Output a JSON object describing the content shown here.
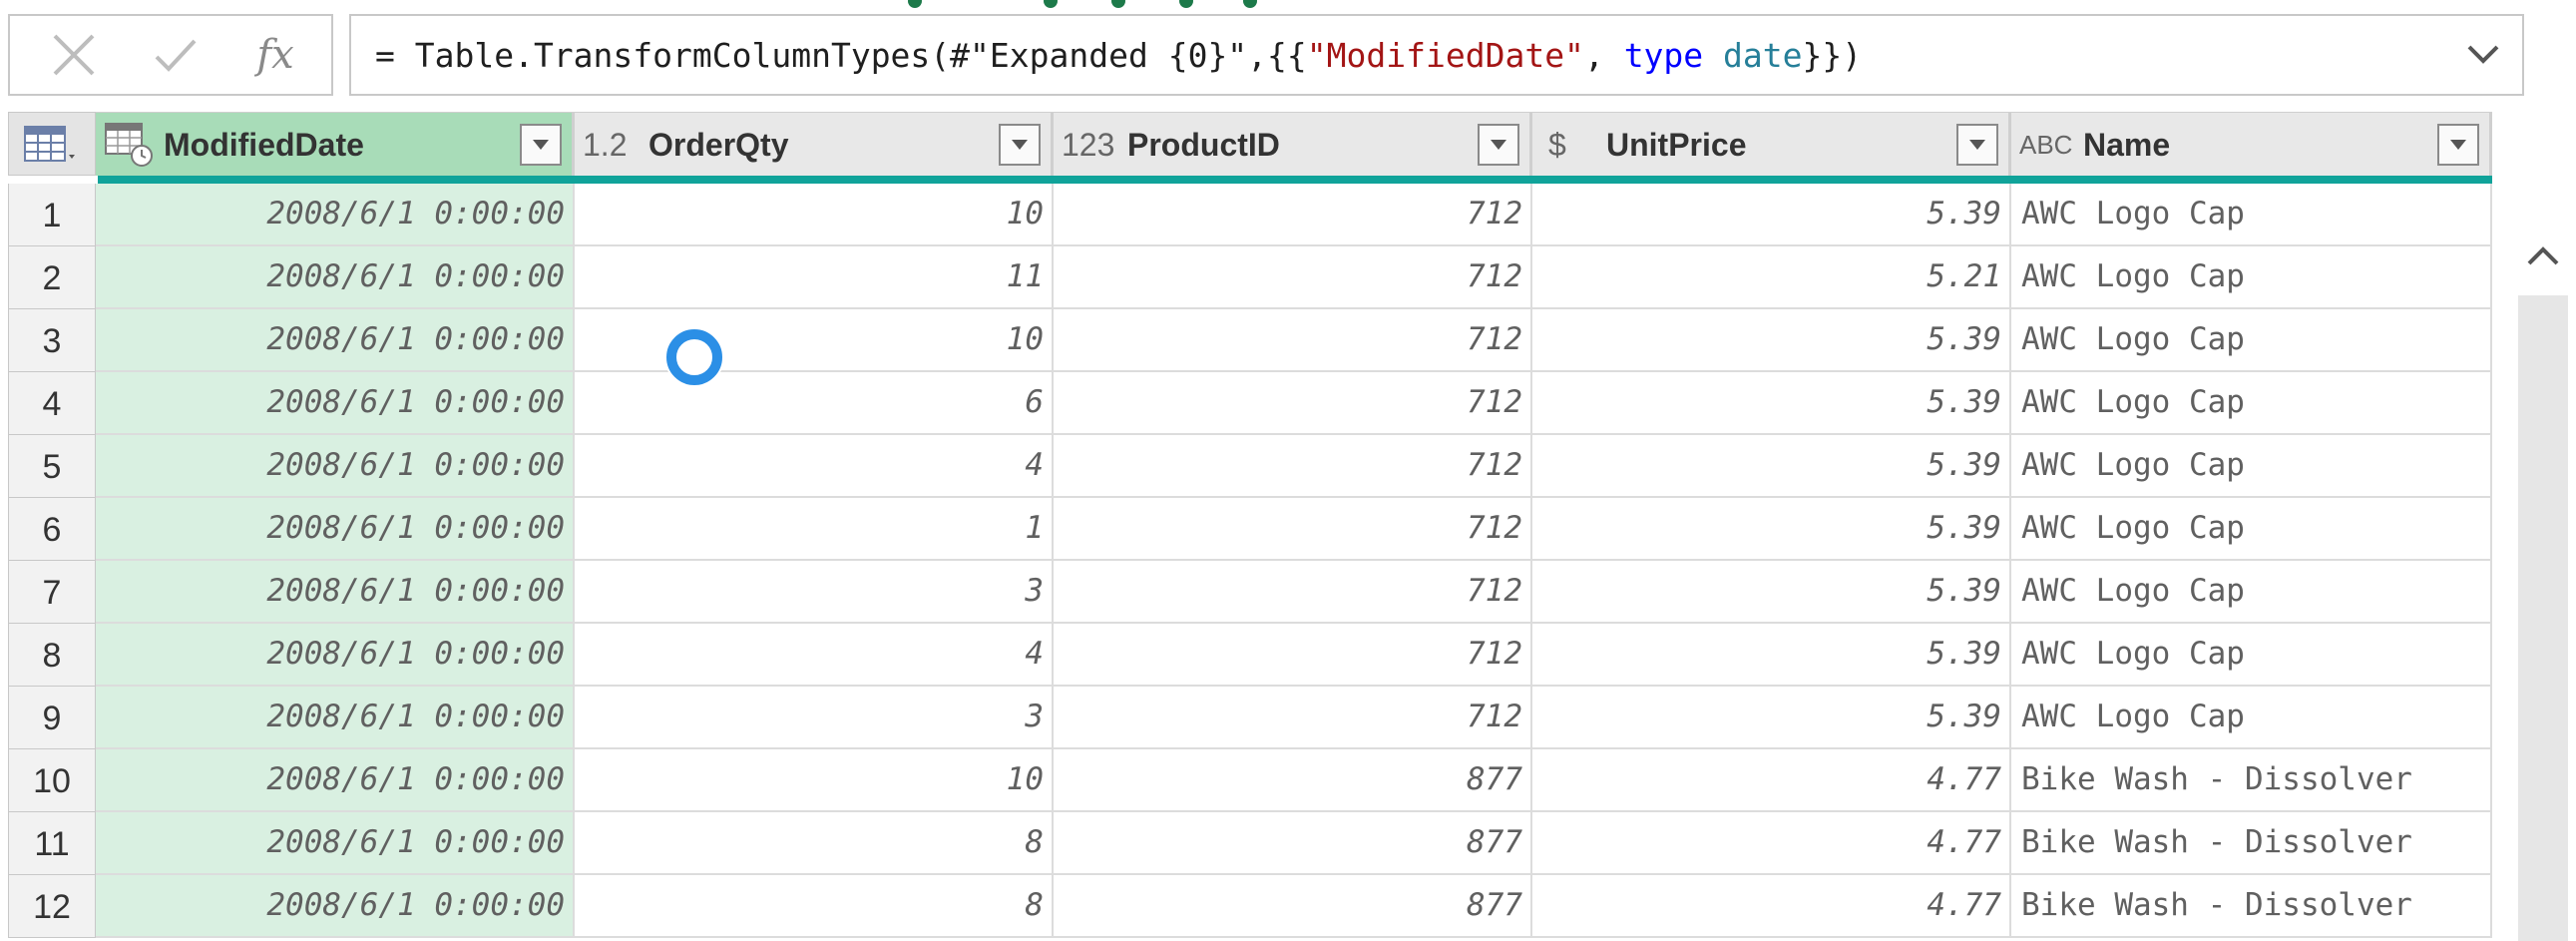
{
  "formula_bar": {
    "cancel_icon": "close-icon",
    "confirm_icon": "check-icon",
    "fx_label": "fx",
    "formula_prefix": "= Table.TransformColumnTypes(#\"Expanded {0}\",{{",
    "formula_string": "\"ModifiedDate\"",
    "formula_sep": ", ",
    "formula_keyword": "type",
    "formula_space": " ",
    "formula_type": "date",
    "formula_suffix": "}})"
  },
  "columns": [
    {
      "name": "ModifiedDate",
      "type_icon": "datetime-type-icon"
    },
    {
      "name": "OrderQty",
      "type_icon": "1.2"
    },
    {
      "name": "ProductID",
      "type_icon": "123"
    },
    {
      "name": "UnitPrice",
      "type_icon": "$"
    },
    {
      "name": "Name",
      "type_icon": "ABC"
    }
  ],
  "rows": [
    {
      "n": "1",
      "date": "2008/6/1 0:00:00",
      "qty": "10",
      "pid": "712",
      "price": "5.39",
      "name": "AWC Logo Cap"
    },
    {
      "n": "2",
      "date": "2008/6/1 0:00:00",
      "qty": "11",
      "pid": "712",
      "price": "5.21",
      "name": "AWC Logo Cap"
    },
    {
      "n": "3",
      "date": "2008/6/1 0:00:00",
      "qty": "10",
      "pid": "712",
      "price": "5.39",
      "name": "AWC Logo Cap"
    },
    {
      "n": "4",
      "date": "2008/6/1 0:00:00",
      "qty": "6",
      "pid": "712",
      "price": "5.39",
      "name": "AWC Logo Cap"
    },
    {
      "n": "5",
      "date": "2008/6/1 0:00:00",
      "qty": "4",
      "pid": "712",
      "price": "5.39",
      "name": "AWC Logo Cap"
    },
    {
      "n": "6",
      "date": "2008/6/1 0:00:00",
      "qty": "1",
      "pid": "712",
      "price": "5.39",
      "name": "AWC Logo Cap"
    },
    {
      "n": "7",
      "date": "2008/6/1 0:00:00",
      "qty": "3",
      "pid": "712",
      "price": "5.39",
      "name": "AWC Logo Cap"
    },
    {
      "n": "8",
      "date": "2008/6/1 0:00:00",
      "qty": "4",
      "pid": "712",
      "price": "5.39",
      "name": "AWC Logo Cap"
    },
    {
      "n": "9",
      "date": "2008/6/1 0:00:00",
      "qty": "3",
      "pid": "712",
      "price": "5.39",
      "name": "AWC Logo Cap"
    },
    {
      "n": "10",
      "date": "2008/6/1 0:00:00",
      "qty": "10",
      "pid": "877",
      "price": "4.77",
      "name": "Bike Wash - Dissolver"
    },
    {
      "n": "11",
      "date": "2008/6/1 0:00:00",
      "qty": "8",
      "pid": "877",
      "price": "4.77",
      "name": "Bike Wash - Dissolver"
    },
    {
      "n": "12",
      "date": "2008/6/1 0:00:00",
      "qty": "8",
      "pid": "877",
      "price": "4.77",
      "name": "Bike Wash - Dissolver"
    }
  ],
  "colors": {
    "active_header": "#a8dcb8",
    "active_column": "#d9f0e1",
    "quality_bar": "#10a39a",
    "spinner": "#2b8fe6",
    "loading_dots": "#1d7a4a"
  }
}
